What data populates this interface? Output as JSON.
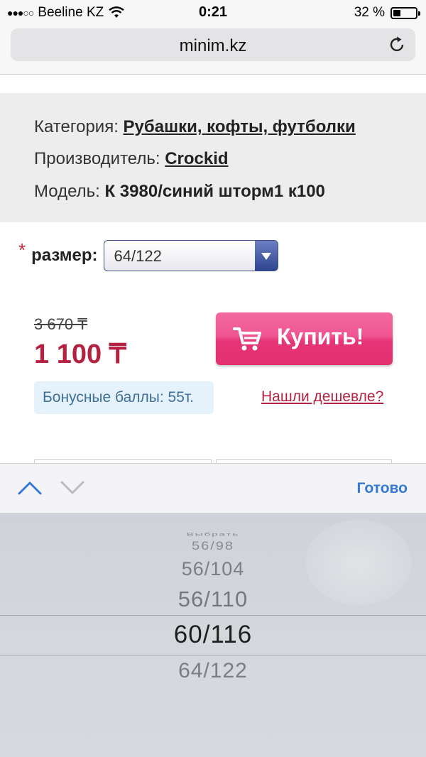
{
  "status_bar": {
    "carrier": "Beeline KZ",
    "time": "0:21",
    "battery": "32 %",
    "battery_level": 0.32
  },
  "browser": {
    "url": "minim.kz"
  },
  "product_info": {
    "category_label": "Категория:",
    "category_value": "Рубашки, кофты, футболки",
    "manufacturer_label": "Производитель:",
    "manufacturer_value": "Crockid",
    "model_label": "Модель:",
    "model_value": "К 3980/синий шторм1 к100"
  },
  "size": {
    "required_mark": "*",
    "label": "размер:",
    "selected": "64/122"
  },
  "price": {
    "old": "3 670 ₸",
    "current": "1 100 ₸"
  },
  "buy_button": {
    "label": "Купить!"
  },
  "bonus": {
    "text": "Бонусные баллы: 55т."
  },
  "cheaper_link": "Нашли дешевле?",
  "picker_toolbar": {
    "done_label": "Готово"
  },
  "picker_options": {
    "above3": "Выбрать",
    "above2": "56/98",
    "above1": "56/104",
    "above0": "56/110",
    "selected": "60/116",
    "below0": "64/122"
  },
  "colors": {
    "price_accent": "#b52241",
    "buy_button": "#e63476",
    "link_blue": "#3478d8"
  }
}
